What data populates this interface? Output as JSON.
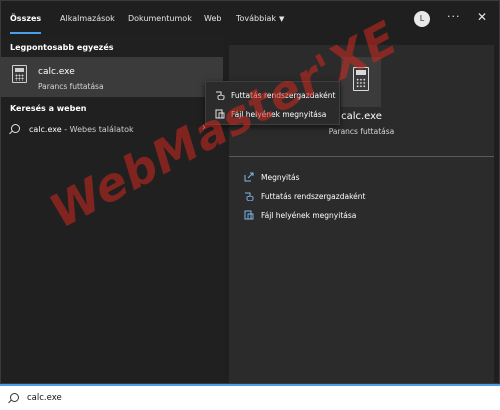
{
  "tabs": [
    {
      "label": "Összes"
    },
    {
      "label": "Alkalmazások"
    },
    {
      "label": "Dokumentumok"
    },
    {
      "label": "Web"
    },
    {
      "label": "Továbbiak"
    }
  ],
  "user": {
    "initial": "L"
  },
  "left": {
    "best_match_title": "Legpontosabb egyezés",
    "best_match": {
      "name": "calc.exe",
      "subtitle": "Parancs futtatása"
    },
    "web_title": "Keresés a weben",
    "web_result": {
      "query": "calc.exe",
      "suffix": " - Webes találatok"
    }
  },
  "context_menu": [
    {
      "label": "Futtatás rendszergazdaként",
      "icon": "shield-run-icon"
    },
    {
      "label": "Fájl helyének megnyitása",
      "icon": "folder-location-icon"
    }
  ],
  "detail": {
    "title": "calc.exe",
    "subtitle": "Parancs futtatása",
    "actions": [
      {
        "label": "Megnyitás",
        "icon": "open-icon"
      },
      {
        "label": "Futtatás rendszergazdaként",
        "icon": "shield-run-icon"
      },
      {
        "label": "Fájl helyének megnyitása",
        "icon": "folder-location-icon"
      }
    ]
  },
  "watermark": "WebMaster'XE",
  "search": {
    "value": "calc.exe"
  },
  "colors": {
    "accent": "#4a9ee8",
    "background": "#1f1f1f",
    "panel": "#2b2b2b",
    "selected": "#3b3b3b",
    "watermark": "#cd281e"
  }
}
